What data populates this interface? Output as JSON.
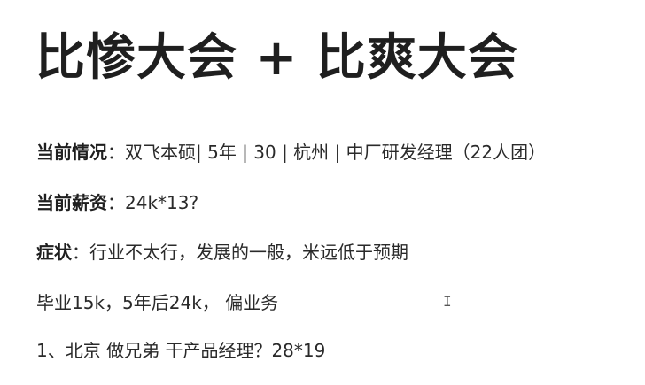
{
  "title": "比惨大会 + 比爽大会",
  "lines": [
    {
      "label": "当前情况",
      "separator": "：",
      "text": "双飞本硕| 5年 | 30 | 杭州 | 中厂研发经理（22人团）"
    },
    {
      "label": "当前薪资",
      "separator": "：",
      "text": "24k*13?"
    },
    {
      "label": "症状",
      "separator": "：",
      "text": "行业不太行，发展的一般，米远低于预期"
    },
    {
      "text": "毕业15k，5年后24k， 偏业务"
    },
    {
      "text": "1、北京 做兄弟 干产品经理？28*19"
    }
  ],
  "cursor": "I"
}
